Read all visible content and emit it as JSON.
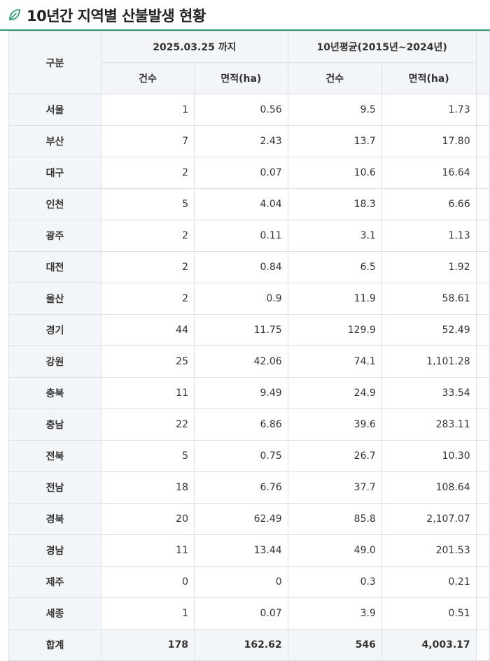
{
  "page": {
    "title": "10년간 지역별 산불발생 현황",
    "accent": "#2e9e6e",
    "header_bg": "#f3f6f8",
    "icon": "leaf-icon"
  },
  "table": {
    "category_label": "구분",
    "group1_label": "2025.03.25 까지",
    "group2_label": "10년평균(2015년~2024년)",
    "sub_labels": [
      "건수",
      "면적(ha)",
      "건수",
      "면적(ha)"
    ],
    "rows": [
      {
        "region": "서울",
        "c1": "1",
        "a1": "0.56",
        "c2": "9.5",
        "a2": "1.73"
      },
      {
        "region": "부산",
        "c1": "7",
        "a1": "2.43",
        "c2": "13.7",
        "a2": "17.80"
      },
      {
        "region": "대구",
        "c1": "2",
        "a1": "0.07",
        "c2": "10.6",
        "a2": "16.64"
      },
      {
        "region": "인천",
        "c1": "5",
        "a1": "4.04",
        "c2": "18.3",
        "a2": "6.66"
      },
      {
        "region": "광주",
        "c1": "2",
        "a1": "0.11",
        "c2": "3.1",
        "a2": "1.13"
      },
      {
        "region": "대전",
        "c1": "2",
        "a1": "0.84",
        "c2": "6.5",
        "a2": "1.92"
      },
      {
        "region": "울산",
        "c1": "2",
        "a1": "0.9",
        "c2": "11.9",
        "a2": "58.61"
      },
      {
        "region": "경기",
        "c1": "44",
        "a1": "11.75",
        "c2": "129.9",
        "a2": "52.49"
      },
      {
        "region": "강원",
        "c1": "25",
        "a1": "42.06",
        "c2": "74.1",
        "a2": "1,101.28"
      },
      {
        "region": "충북",
        "c1": "11",
        "a1": "9.49",
        "c2": "24.9",
        "a2": "33.54"
      },
      {
        "region": "충남",
        "c1": "22",
        "a1": "6.86",
        "c2": "39.6",
        "a2": "283.11"
      },
      {
        "region": "전북",
        "c1": "5",
        "a1": "0.75",
        "c2": "26.7",
        "a2": "10.30"
      },
      {
        "region": "전남",
        "c1": "18",
        "a1": "6.76",
        "c2": "37.7",
        "a2": "108.64"
      },
      {
        "region": "경북",
        "c1": "20",
        "a1": "62.49",
        "c2": "85.8",
        "a2": "2,107.07"
      },
      {
        "region": "경남",
        "c1": "11",
        "a1": "13.44",
        "c2": "49.0",
        "a2": "201.53"
      },
      {
        "region": "제주",
        "c1": "0",
        "a1": "0",
        "c2": "0.3",
        "a2": "0.21"
      },
      {
        "region": "세종",
        "c1": "1",
        "a1": "0.07",
        "c2": "3.9",
        "a2": "0.51"
      },
      {
        "region": "합계",
        "c1": "178",
        "a1": "162.62",
        "c2": "546",
        "a2": "4,003.17"
      }
    ]
  }
}
